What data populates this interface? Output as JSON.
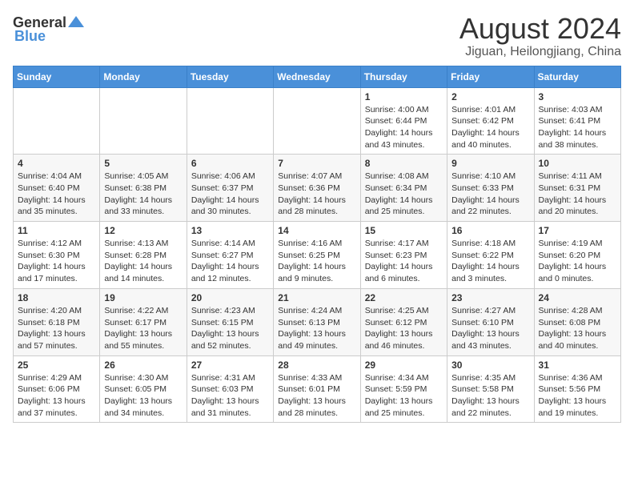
{
  "logo": {
    "general": "General",
    "blue": "Blue"
  },
  "title": "August 2024",
  "subtitle": "Jiguan, Heilongjiang, China",
  "weekdays": [
    "Sunday",
    "Monday",
    "Tuesday",
    "Wednesday",
    "Thursday",
    "Friday",
    "Saturday"
  ],
  "weeks": [
    [
      {
        "day": "",
        "info": ""
      },
      {
        "day": "",
        "info": ""
      },
      {
        "day": "",
        "info": ""
      },
      {
        "day": "",
        "info": ""
      },
      {
        "day": "1",
        "info": "Sunrise: 4:00 AM\nSunset: 6:44 PM\nDaylight: 14 hours\nand 43 minutes."
      },
      {
        "day": "2",
        "info": "Sunrise: 4:01 AM\nSunset: 6:42 PM\nDaylight: 14 hours\nand 40 minutes."
      },
      {
        "day": "3",
        "info": "Sunrise: 4:03 AM\nSunset: 6:41 PM\nDaylight: 14 hours\nand 38 minutes."
      }
    ],
    [
      {
        "day": "4",
        "info": "Sunrise: 4:04 AM\nSunset: 6:40 PM\nDaylight: 14 hours\nand 35 minutes."
      },
      {
        "day": "5",
        "info": "Sunrise: 4:05 AM\nSunset: 6:38 PM\nDaylight: 14 hours\nand 33 minutes."
      },
      {
        "day": "6",
        "info": "Sunrise: 4:06 AM\nSunset: 6:37 PM\nDaylight: 14 hours\nand 30 minutes."
      },
      {
        "day": "7",
        "info": "Sunrise: 4:07 AM\nSunset: 6:36 PM\nDaylight: 14 hours\nand 28 minutes."
      },
      {
        "day": "8",
        "info": "Sunrise: 4:08 AM\nSunset: 6:34 PM\nDaylight: 14 hours\nand 25 minutes."
      },
      {
        "day": "9",
        "info": "Sunrise: 4:10 AM\nSunset: 6:33 PM\nDaylight: 14 hours\nand 22 minutes."
      },
      {
        "day": "10",
        "info": "Sunrise: 4:11 AM\nSunset: 6:31 PM\nDaylight: 14 hours\nand 20 minutes."
      }
    ],
    [
      {
        "day": "11",
        "info": "Sunrise: 4:12 AM\nSunset: 6:30 PM\nDaylight: 14 hours\nand 17 minutes."
      },
      {
        "day": "12",
        "info": "Sunrise: 4:13 AM\nSunset: 6:28 PM\nDaylight: 14 hours\nand 14 minutes."
      },
      {
        "day": "13",
        "info": "Sunrise: 4:14 AM\nSunset: 6:27 PM\nDaylight: 14 hours\nand 12 minutes."
      },
      {
        "day": "14",
        "info": "Sunrise: 4:16 AM\nSunset: 6:25 PM\nDaylight: 14 hours\nand 9 minutes."
      },
      {
        "day": "15",
        "info": "Sunrise: 4:17 AM\nSunset: 6:23 PM\nDaylight: 14 hours\nand 6 minutes."
      },
      {
        "day": "16",
        "info": "Sunrise: 4:18 AM\nSunset: 6:22 PM\nDaylight: 14 hours\nand 3 minutes."
      },
      {
        "day": "17",
        "info": "Sunrise: 4:19 AM\nSunset: 6:20 PM\nDaylight: 14 hours\nand 0 minutes."
      }
    ],
    [
      {
        "day": "18",
        "info": "Sunrise: 4:20 AM\nSunset: 6:18 PM\nDaylight: 13 hours\nand 57 minutes."
      },
      {
        "day": "19",
        "info": "Sunrise: 4:22 AM\nSunset: 6:17 PM\nDaylight: 13 hours\nand 55 minutes."
      },
      {
        "day": "20",
        "info": "Sunrise: 4:23 AM\nSunset: 6:15 PM\nDaylight: 13 hours\nand 52 minutes."
      },
      {
        "day": "21",
        "info": "Sunrise: 4:24 AM\nSunset: 6:13 PM\nDaylight: 13 hours\nand 49 minutes."
      },
      {
        "day": "22",
        "info": "Sunrise: 4:25 AM\nSunset: 6:12 PM\nDaylight: 13 hours\nand 46 minutes."
      },
      {
        "day": "23",
        "info": "Sunrise: 4:27 AM\nSunset: 6:10 PM\nDaylight: 13 hours\nand 43 minutes."
      },
      {
        "day": "24",
        "info": "Sunrise: 4:28 AM\nSunset: 6:08 PM\nDaylight: 13 hours\nand 40 minutes."
      }
    ],
    [
      {
        "day": "25",
        "info": "Sunrise: 4:29 AM\nSunset: 6:06 PM\nDaylight: 13 hours\nand 37 minutes."
      },
      {
        "day": "26",
        "info": "Sunrise: 4:30 AM\nSunset: 6:05 PM\nDaylight: 13 hours\nand 34 minutes."
      },
      {
        "day": "27",
        "info": "Sunrise: 4:31 AM\nSunset: 6:03 PM\nDaylight: 13 hours\nand 31 minutes."
      },
      {
        "day": "28",
        "info": "Sunrise: 4:33 AM\nSunset: 6:01 PM\nDaylight: 13 hours\nand 28 minutes."
      },
      {
        "day": "29",
        "info": "Sunrise: 4:34 AM\nSunset: 5:59 PM\nDaylight: 13 hours\nand 25 minutes."
      },
      {
        "day": "30",
        "info": "Sunrise: 4:35 AM\nSunset: 5:58 PM\nDaylight: 13 hours\nand 22 minutes."
      },
      {
        "day": "31",
        "info": "Sunrise: 4:36 AM\nSunset: 5:56 PM\nDaylight: 13 hours\nand 19 minutes."
      }
    ]
  ]
}
